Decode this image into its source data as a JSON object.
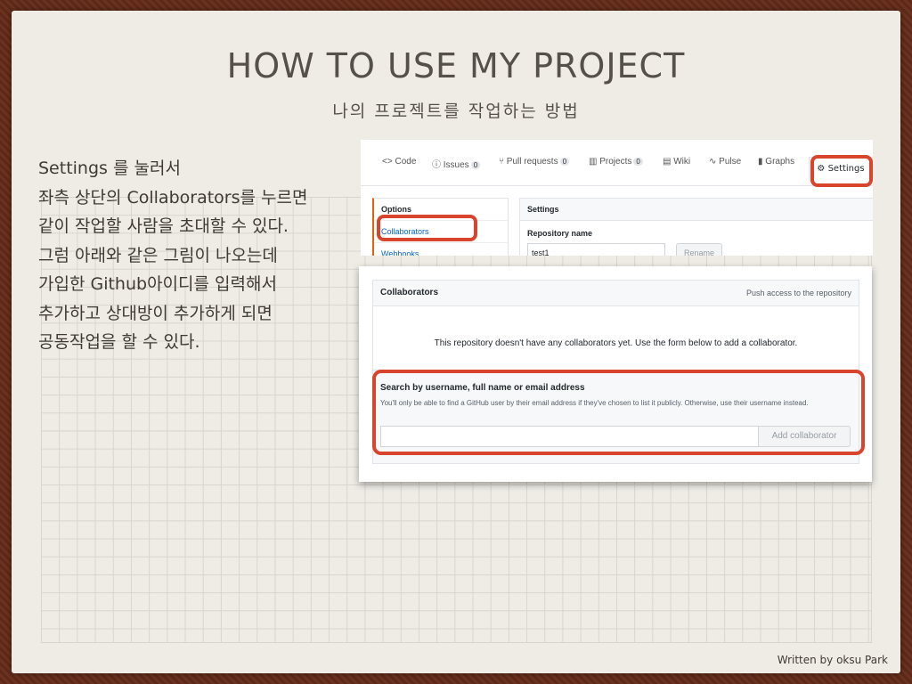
{
  "slide": {
    "title": "HOW TO USE MY PROJECT",
    "subtitle": "나의 프로젝트를 작업하는 방법",
    "body_lines": [
      "Settings 를 눌러서",
      "좌측 상단의 Collaborators를 누르면",
      "같이 작업할 사람을 초대할 수 있다.",
      "그럼 아래와 같은 그림이 나오는데",
      "가입한 Github아이디를 입력해서",
      "추가하고 상대방이 추가하게 되면",
      "공동작업을 할 수 있다."
    ],
    "credit": "Written by oksu Park"
  },
  "repo_nav": {
    "code": "Code",
    "issues": "Issues",
    "issues_count": "0",
    "pull_requests": "Pull requests",
    "pull_requests_count": "0",
    "projects": "Projects",
    "projects_count": "0",
    "wiki": "Wiki",
    "pulse": "Pulse",
    "graphs": "Graphs",
    "settings": "Settings"
  },
  "settings_menu": {
    "options": "Options",
    "collaborators": "Collaborators",
    "webhooks": "Webhooks"
  },
  "settings_panel": {
    "header": "Settings",
    "repo_name_label": "Repository name",
    "repo_name_value": "test1",
    "rename_button": "Rename"
  },
  "collaborators": {
    "title": "Collaborators",
    "push_access": "Push access to the repository",
    "empty_message": "This repository doesn't have any collaborators yet. Use the form below to add a collaborator.",
    "search_title": "Search by username, full name or email address",
    "search_desc": "You'll only be able to find a GitHub user by their email address if they've chosen to list it publicly. Otherwise, use their username instead.",
    "search_value": "",
    "add_button": "Add collaborator"
  },
  "colors": {
    "highlight_ring": "#d9452c",
    "link": "#0366d6",
    "slide_bg": "#efece6",
    "frame": "#5a2a1a"
  }
}
